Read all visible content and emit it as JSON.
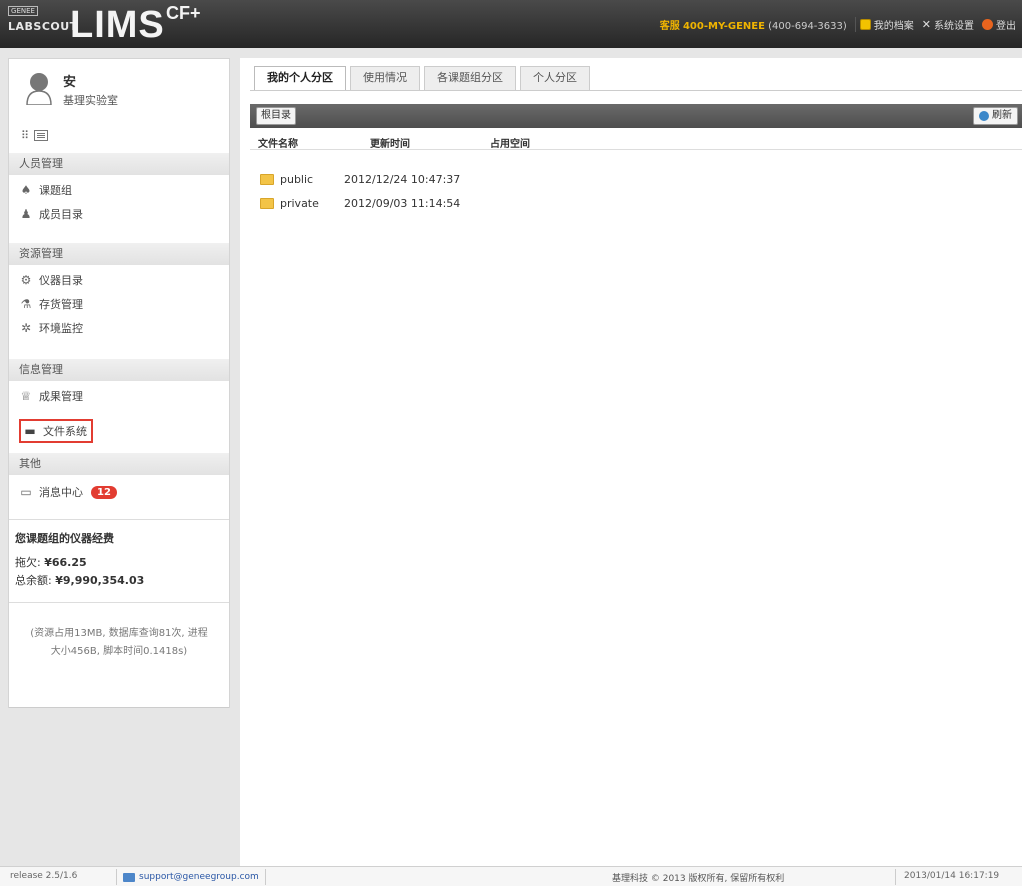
{
  "header": {
    "logo_small": "GENEE",
    "logo_lab": "LABSCOUT",
    "logo_main": "LIMS",
    "logo_sup": "CF+",
    "hotline_prefix": "客服",
    "hotline_number": "400-MY-GENEE",
    "hotline_alt": "(400-694-3633)",
    "links": [
      {
        "label": "我的档案",
        "icon": "profile-icon"
      },
      {
        "label": "系统设置",
        "icon": "wrench-icon"
      },
      {
        "label": "登出",
        "icon": "logout-icon"
      }
    ]
  },
  "sidebar": {
    "user_name": "安",
    "user_lab": "基理实验室",
    "view_toggle": "⠿",
    "sections": [
      {
        "title": "人员管理",
        "items": [
          {
            "label": "课题组",
            "icon": "group-icon"
          },
          {
            "label": "成员目录",
            "icon": "member-icon"
          }
        ]
      },
      {
        "title": "资源管理",
        "items": [
          {
            "label": "仪器目录",
            "icon": "instrument-icon"
          },
          {
            "label": "存货管理",
            "icon": "inventory-icon"
          },
          {
            "label": "环境监控",
            "icon": "environment-icon"
          }
        ]
      },
      {
        "title": "信息管理",
        "items": [
          {
            "label": "成果管理",
            "icon": "achievement-icon"
          },
          {
            "label": "文件系统",
            "icon": "folder-icon"
          }
        ]
      },
      {
        "title": "其他",
        "items": [
          {
            "label": "消息中心",
            "icon": "message-icon",
            "badge": "12"
          }
        ]
      }
    ],
    "fee_title": "您课题组的仪器经费",
    "fee_lines": [
      {
        "label": "拖欠:",
        "value": "¥66.25"
      },
      {
        "label": "总余额:",
        "value": "¥9,990,354.03"
      }
    ],
    "stats": "(资源占用13MB, 数据库查询81次, 进程大小456B, 脚本时间0.1418s)"
  },
  "main": {
    "tabs": [
      "我的个人分区",
      "使用情况",
      "各课题组分区",
      "个人分区"
    ],
    "active_tab": 0,
    "root_label": "根目录",
    "refresh_label": "刷新",
    "columns": [
      "文件名称",
      "更新时间",
      "占用空间"
    ],
    "files": [
      {
        "name": "public",
        "time": "2012/12/24 10:47:37",
        "size": ""
      },
      {
        "name": "private",
        "time": "2012/09/03 11:14:54",
        "size": ""
      }
    ]
  },
  "footer": {
    "release": "release 2.5/1.6",
    "email": "support@geneegroup.com",
    "copyright": "基理科技 © 2013 版权所有, 保留所有权利",
    "timestamp": "2013/01/14 16:17:19"
  },
  "colors": {
    "highlight": "#e23c31",
    "accent": "#f0b400",
    "link": "#2a57a6"
  }
}
